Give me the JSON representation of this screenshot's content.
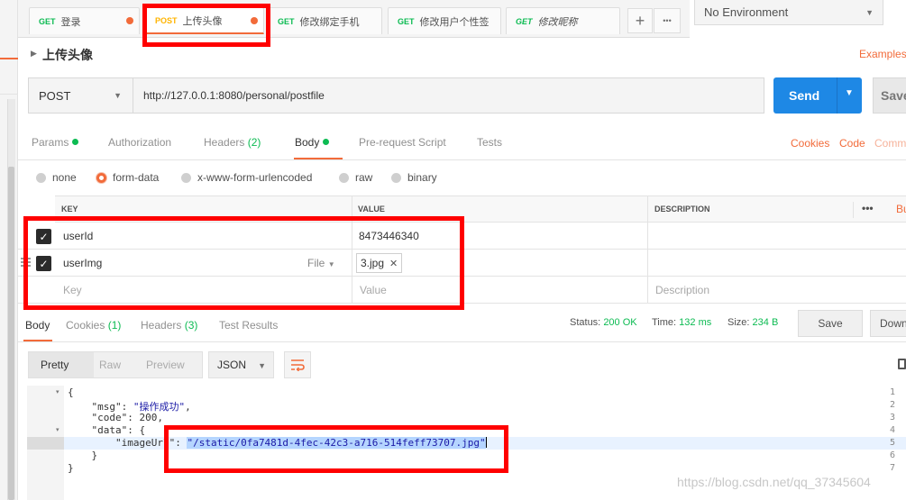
{
  "tabs": [
    {
      "method": "GET",
      "label": "登录",
      "italic": false
    },
    {
      "method": "POST",
      "label": "上传头像",
      "italic": false
    },
    {
      "method": "GET",
      "label": "修改绑定手机",
      "italic": false
    },
    {
      "method": "GET",
      "label": "修改用户个性签",
      "italic": false
    },
    {
      "method": "GET",
      "label": "修改昵称",
      "italic": true
    }
  ],
  "tab_actions": {
    "add": "+",
    "more": "•••"
  },
  "environment": {
    "selected": "No Environment"
  },
  "request": {
    "title": "上传头像",
    "examples_label": "Examples",
    "method": "POST",
    "url": "http://127.0.0.1:8080/personal/postfile",
    "send_label": "Send",
    "save_label": "Save"
  },
  "request_tabs": {
    "params": "Params",
    "authorization": "Authorization",
    "headers": "Headers",
    "headers_count": "(2)",
    "body": "Body",
    "prerequest": "Pre-request Script",
    "tests": "Tests",
    "cookies": "Cookies",
    "code": "Code",
    "comments": "Comm"
  },
  "body_modes": {
    "none": "none",
    "form_data": "form-data",
    "urlencoded": "x-www-form-urlencoded",
    "raw": "raw",
    "binary": "binary"
  },
  "form_table": {
    "headers": {
      "key": "KEY",
      "value": "VALUE",
      "description": "DESCRIPTION",
      "more": "•••",
      "bulk": "Bu"
    },
    "rows": [
      {
        "key": "userId",
        "value": "8473446340"
      },
      {
        "key": "userImg",
        "type": "File",
        "file": "3.jpg",
        "remove": "✕"
      }
    ],
    "placeholders": {
      "key": "Key",
      "value": "Value",
      "description": "Description"
    }
  },
  "response": {
    "tabs": {
      "body": "Body",
      "cookies": "Cookies",
      "cookies_count": "(1)",
      "headers": "Headers",
      "headers_count": "(3)",
      "test_results": "Test Results"
    },
    "status_label": "Status:",
    "status_value": "200 OK",
    "time_label": "Time:",
    "time_value": "132 ms",
    "size_label": "Size:",
    "size_value": "234 B",
    "save_label": "Save",
    "download_label": "Down",
    "views": {
      "pretty": "Pretty",
      "raw": "Raw",
      "preview": "Preview"
    },
    "format": "JSON",
    "code_lines": [
      {
        "n": "1",
        "fold": "▾",
        "text": "{"
      },
      {
        "n": "2",
        "fold": "",
        "key": "\"msg\"",
        "value": "\"操作成功\"",
        "tail": ","
      },
      {
        "n": "3",
        "fold": "",
        "key": "\"code\"",
        "value": "200",
        "tail": ","
      },
      {
        "n": "4",
        "fold": "▾",
        "key": "\"data\"",
        "value": "{",
        "tail": ""
      },
      {
        "n": "5",
        "fold": "",
        "key": "\"imageUrl\"",
        "value": "\"/static/0fa7481d-4fec-42c3-a716-514feff73707.jpg\"",
        "tail": ""
      },
      {
        "n": "6",
        "fold": "",
        "text": "    }"
      },
      {
        "n": "7",
        "fold": "",
        "text": "}"
      }
    ]
  },
  "watermark": "https://blog.csdn.net/qq_37345604",
  "colors": {
    "accent": "#f26b3a",
    "send": "#1e88e5",
    "get": "#0cbb52",
    "post": "#ffb400",
    "annotation": "#ff0000"
  }
}
